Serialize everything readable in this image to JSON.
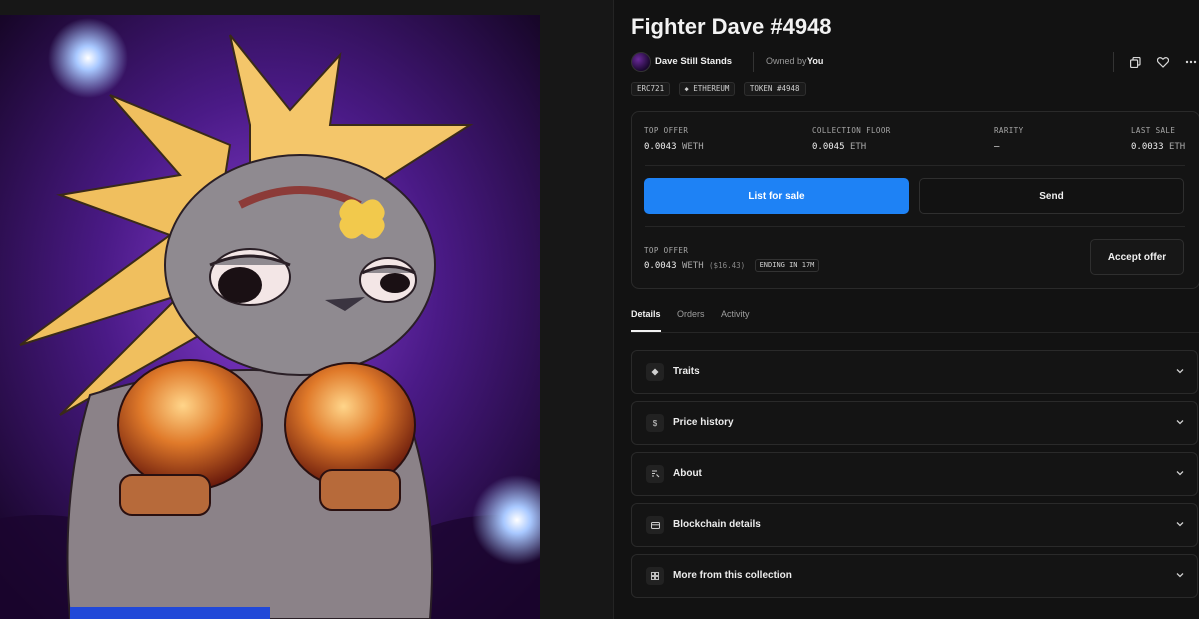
{
  "asset": {
    "title": "Fighter Dave #4948",
    "creator": "Dave Still Stands",
    "owner_label": "Owned by",
    "owner": "You",
    "tags": [
      "ERC721",
      "ETHEREUM",
      "TOKEN #4948"
    ]
  },
  "stats": {
    "top_offer": {
      "label": "TOP OFFER",
      "value": "0.0043",
      "unit": "WETH"
    },
    "collection_floor": {
      "label": "COLLECTION FLOOR",
      "value": "0.0045",
      "unit": "ETH"
    },
    "rarity": {
      "label": "RARITY",
      "value": "–"
    },
    "last_sale": {
      "label": "LAST SALE",
      "value": "0.0033",
      "unit": "ETH"
    }
  },
  "actions": {
    "list_for_sale": "List for sale",
    "send": "Send",
    "accept_offer": "Accept offer"
  },
  "offer": {
    "label": "TOP OFFER",
    "value": "0.0043",
    "unit": "WETH",
    "usd": "($16.43)",
    "ending": "ENDING IN 17M"
  },
  "tabs": [
    "Details",
    "Orders",
    "Activity"
  ],
  "active_tab": "Details",
  "sections": [
    {
      "label": "Traits",
      "icon": "diamond-icon"
    },
    {
      "label": "Price history",
      "icon": "dollar-icon"
    },
    {
      "label": "About",
      "icon": "info-icon"
    },
    {
      "label": "Blockchain details",
      "icon": "chain-icon"
    },
    {
      "label": "More from this collection",
      "icon": "grid-icon"
    }
  ],
  "colors": {
    "background": "#121212",
    "primary_button": "#1e82f5",
    "artwork_glow": "#7a2bd0"
  }
}
